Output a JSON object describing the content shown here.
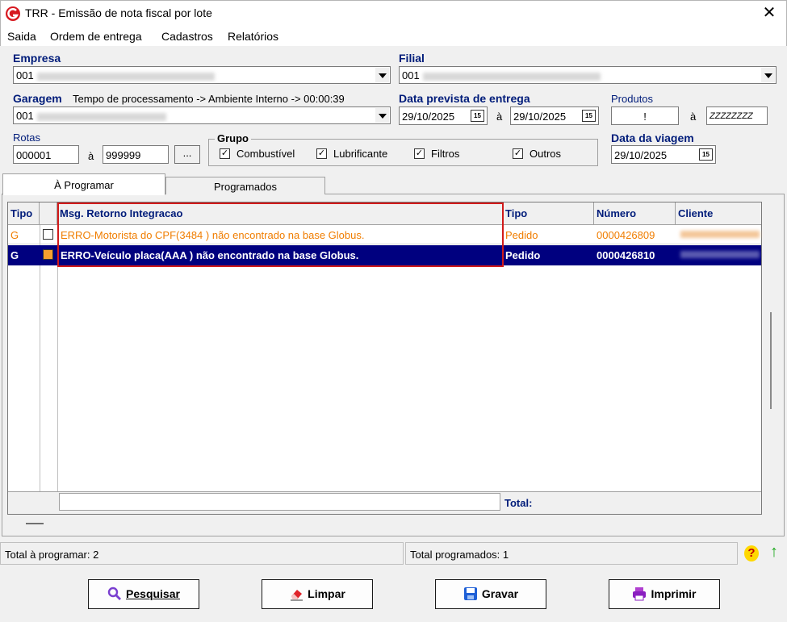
{
  "window": {
    "title": "TRR - Emissão de nota fiscal por lote",
    "close_glyph": "✕"
  },
  "menu": [
    "Saida",
    "Ordem de entrega",
    "Cadastros",
    "Relatórios"
  ],
  "form": {
    "empresa_label": "Empresa",
    "empresa_value": "001",
    "filial_label": "Filial",
    "filial_value": "001",
    "garagem_label": "Garagem",
    "garagem_value": "001",
    "tempo_text": "Tempo de processamento -> Ambiente Interno -> 00:00:39",
    "data_prevista_label": "Data prevista de entrega",
    "data_prevista_from": "29/10/2025",
    "data_prevista_sep": "à",
    "data_prevista_to": "29/10/2025",
    "produtos_label": "Produtos",
    "produtos_from": "!",
    "produtos_sep": "à",
    "produtos_to": "ZZZZZZZZ",
    "rotas_label": "Rotas",
    "rotas_from": "000001",
    "rotas_sep": "à",
    "rotas_to": "999999",
    "rotas_btn": "...",
    "grupo_label": "Grupo",
    "grupo_items": [
      {
        "label": "Combustível",
        "checked": true
      },
      {
        "label": "Lubrificante",
        "checked": true
      },
      {
        "label": "Filtros",
        "checked": true
      },
      {
        "label": "Outros",
        "checked": true
      }
    ],
    "check_glyph": "✓",
    "data_viagem_label": "Data da viagem",
    "data_viagem_value": "29/10/2025",
    "cal_glyph": "15"
  },
  "tabs": [
    {
      "label": "À Programar",
      "active": true
    },
    {
      "label": "Programados",
      "active": false
    }
  ],
  "grid": {
    "columns": [
      "Tipo",
      "Msg. Retorno Integracao",
      "Tipo",
      "Número",
      "Cliente"
    ],
    "rows": [
      {
        "tipo": "G",
        "msg": "ERRO-Motorista do CPF(3484        ) não encontrado na base Globus.",
        "tipo2": "Pedido",
        "numero": "0000426809",
        "selected": false
      },
      {
        "tipo": "G",
        "msg": "ERRO-Veículo placa(AAA      ) não encontrado na base Globus.",
        "tipo2": "Pedido",
        "numero": "0000426810",
        "selected": true
      }
    ],
    "total_label": "Total:"
  },
  "status": {
    "left": "Total à programar: 2",
    "right": "Total programados: 1",
    "help_glyph": "?",
    "up_glyph": "↑"
  },
  "buttons": {
    "pesquisar": "Pesquisar",
    "limpar": "Limpar",
    "gravar": "Gravar",
    "imprimir": "Imprimir"
  },
  "colors": {
    "label_blue": "#001c7a",
    "row_error": "#f07d00",
    "selection": "#00007f",
    "highlight_box": "#d11a1a"
  }
}
